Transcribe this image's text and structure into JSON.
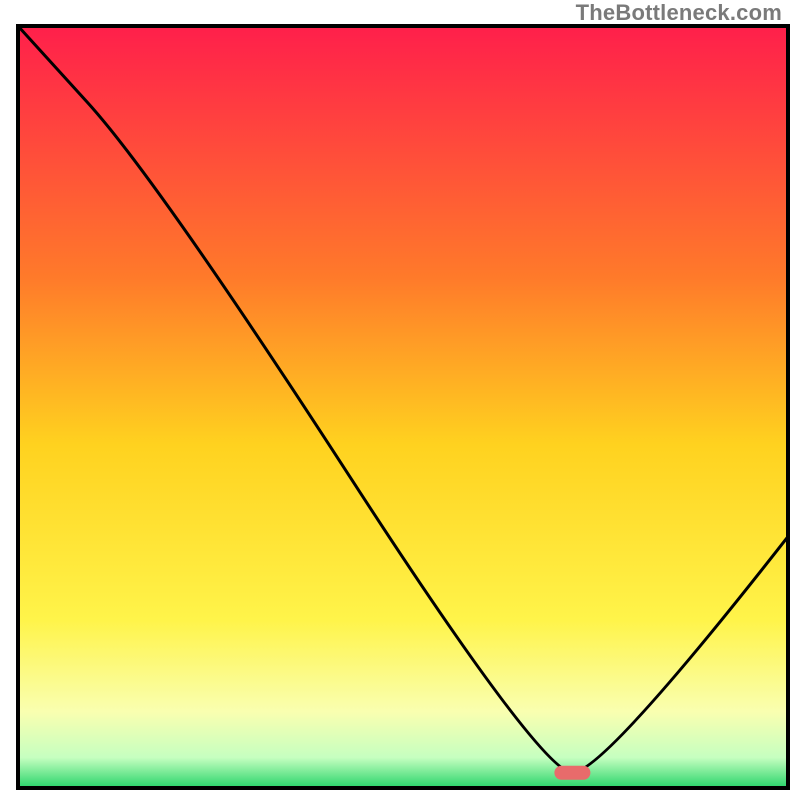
{
  "watermark": "TheBottleneck.com",
  "chart_data": {
    "type": "line",
    "title": "",
    "xlabel": "",
    "ylabel": "",
    "xlim": [
      0,
      100
    ],
    "ylim": [
      0,
      100
    ],
    "series": [
      {
        "name": "curve",
        "x": [
          0,
          18,
          68,
          76,
          100
        ],
        "y": [
          100,
          80,
          2,
          2,
          33
        ]
      }
    ],
    "gradient_stops": [
      {
        "offset": 0,
        "color": "#ff1f4b"
      },
      {
        "offset": 0.33,
        "color": "#ff7a2a"
      },
      {
        "offset": 0.55,
        "color": "#ffd21f"
      },
      {
        "offset": 0.78,
        "color": "#fff44a"
      },
      {
        "offset": 0.9,
        "color": "#f9ffb0"
      },
      {
        "offset": 0.96,
        "color": "#c6ffc0"
      },
      {
        "offset": 1.0,
        "color": "#28d46a"
      }
    ],
    "marker": {
      "x": 72,
      "y": 2,
      "color": "#e86b6b",
      "rx": 7,
      "w": 36,
      "h": 14
    },
    "frame_stroke": "#000000",
    "frame_stroke_width": 4,
    "curve_stroke": "#000000",
    "curve_stroke_width": 3
  }
}
